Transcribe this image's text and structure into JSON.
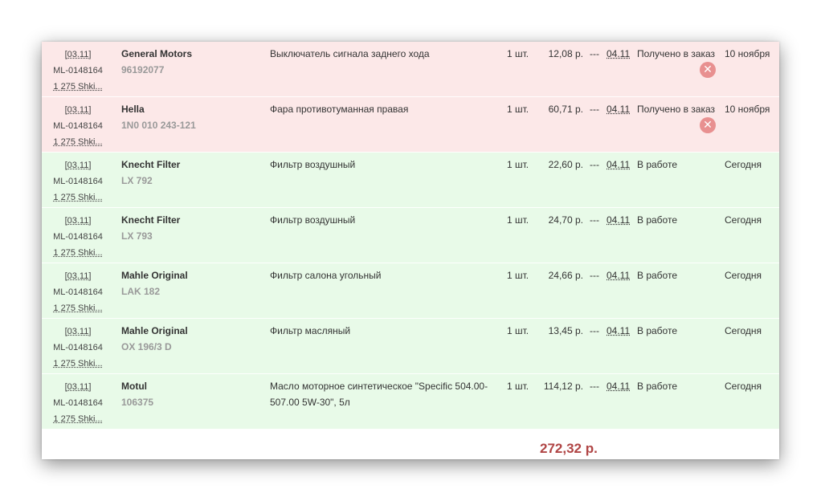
{
  "orders": [
    {
      "date": "03.11",
      "order_id": "ML-0148164",
      "account": "1 275 Shki...",
      "brand": "General Motors",
      "part_code": "96192077",
      "description": "Выключатель сигнала заднего хода",
      "qty": "1 шт.",
      "price": "12,08 р.",
      "dash": "---",
      "ship_date": "04.11",
      "status": "Получено в заказ",
      "delivery": "10 ноября",
      "row_state": "pink",
      "cancel_icon": "cancel-icon"
    },
    {
      "date": "03.11",
      "order_id": "ML-0148164",
      "account": "1 275 Shki...",
      "brand": "Hella",
      "part_code": "1N0 010 243-121",
      "description": "Фара противотуманная правая",
      "qty": "1 шт.",
      "price": "60,71 р.",
      "dash": "---",
      "ship_date": "04.11",
      "status": "Получено в заказ",
      "delivery": "10 ноября",
      "row_state": "pink",
      "cancel_icon": "cancel-icon"
    },
    {
      "date": "03.11",
      "order_id": "ML-0148164",
      "account": "1 275 Shki...",
      "brand": "Knecht Filter",
      "part_code": "LX 792",
      "description": "Фильтр воздушный",
      "qty": "1 шт.",
      "price": "22,60 р.",
      "dash": "---",
      "ship_date": "04.11",
      "status": "В работе",
      "delivery": "Сегодня",
      "row_state": "green"
    },
    {
      "date": "03.11",
      "order_id": "ML-0148164",
      "account": "1 275 Shki...",
      "brand": "Knecht Filter",
      "part_code": "LX 793",
      "description": "Фильтр воздушный",
      "qty": "1 шт.",
      "price": "24,70 р.",
      "dash": "---",
      "ship_date": "04.11",
      "status": "В работе",
      "delivery": "Сегодня",
      "row_state": "green"
    },
    {
      "date": "03.11",
      "order_id": "ML-0148164",
      "account": "1 275 Shki...",
      "brand": "Mahle Original",
      "part_code": "LAK 182",
      "description": "Фильтр салона угольный",
      "qty": "1 шт.",
      "price": "24,66 р.",
      "dash": "---",
      "ship_date": "04.11",
      "status": "В работе",
      "delivery": "Сегодня",
      "row_state": "green"
    },
    {
      "date": "03.11",
      "order_id": "ML-0148164",
      "account": "1 275 Shki...",
      "brand": "Mahle Original",
      "part_code": "OX 196/3 D",
      "description": "Фильтр масляный",
      "qty": "1 шт.",
      "price": "13,45 р.",
      "dash": "---",
      "ship_date": "04.11",
      "status": "В работе",
      "delivery": "Сегодня",
      "row_state": "green"
    },
    {
      "date": "03.11",
      "order_id": "ML-0148164",
      "account": "1 275 Shki...",
      "brand": "Motul",
      "part_code": "106375",
      "description": "Масло моторное синтетическое \"Specific 504.00-507.00 5W-30\", 5л",
      "qty": "1 шт.",
      "price": "114,12 р.",
      "dash": "---",
      "ship_date": "04.11",
      "status": "В работе",
      "delivery": "Сегодня",
      "row_state": "green"
    }
  ],
  "total": "272,32 р.",
  "colors": {
    "pink_row": "#fce8e8",
    "green_row": "#e8fae8",
    "total": "#b04545",
    "cancel": "#e89090"
  }
}
